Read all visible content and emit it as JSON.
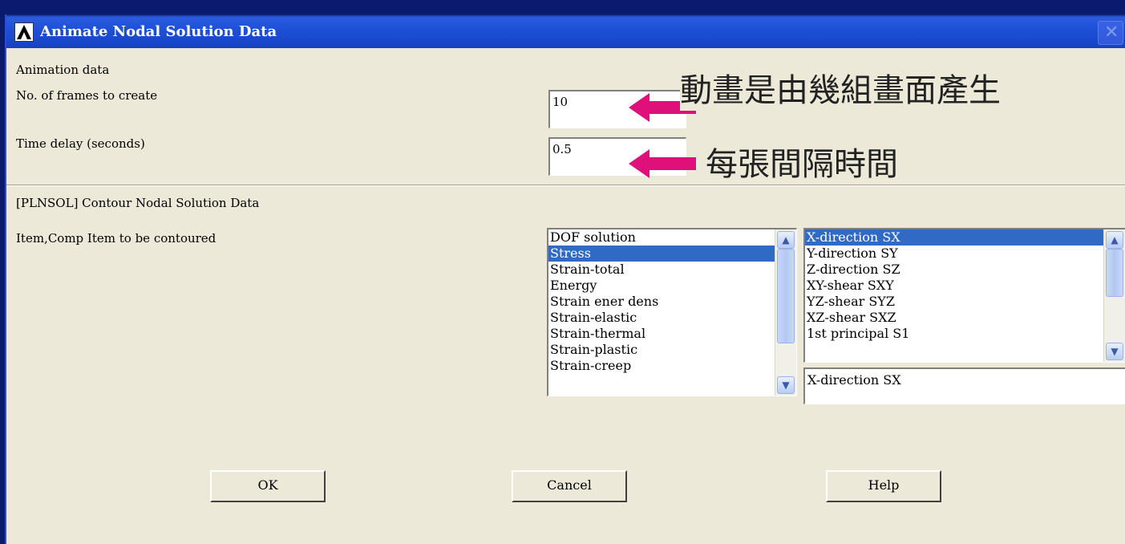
{
  "window": {
    "title": "Animate Nodal Solution Data",
    "close_glyph": "✕"
  },
  "section_animation": {
    "header": "Animation data",
    "frames_label": "No. of frames to create",
    "frames_value": "10",
    "delay_label": "Time delay (seconds)",
    "delay_value": "0.5"
  },
  "section_contour": {
    "header": "[PLNSOL]  Contour Nodal Solution Data",
    "item_label": "Item,Comp   Item to be contoured",
    "items": [
      "DOF solution",
      "Stress",
      "Strain-total",
      "Energy",
      "Strain ener dens",
      "Strain-elastic",
      "Strain-thermal",
      "Strain-plastic",
      "Strain-creep"
    ],
    "selected_item_index": 1,
    "components": [
      "X-direction  SX",
      "Y-direction  SY",
      "Z-direction  SZ",
      "XY-shear    SXY",
      "YZ-shear    SYZ",
      "XZ-shear    SXZ",
      "1st principal S1"
    ],
    "selected_component_index": 0,
    "component_value": "X-direction  SX"
  },
  "buttons": {
    "ok": "OK",
    "cancel": "Cancel",
    "help": "Help"
  },
  "annotations": {
    "frames_note": "動畫是由幾組畫面產生",
    "delay_note": "每張間隔時間",
    "arrow_color": "#e0107a"
  },
  "colors": {
    "dialog_bg": "#ece9d8",
    "titlebar": "#1c4fd6",
    "selection": "#316ac5",
    "desktop": "#0a1a6e"
  }
}
